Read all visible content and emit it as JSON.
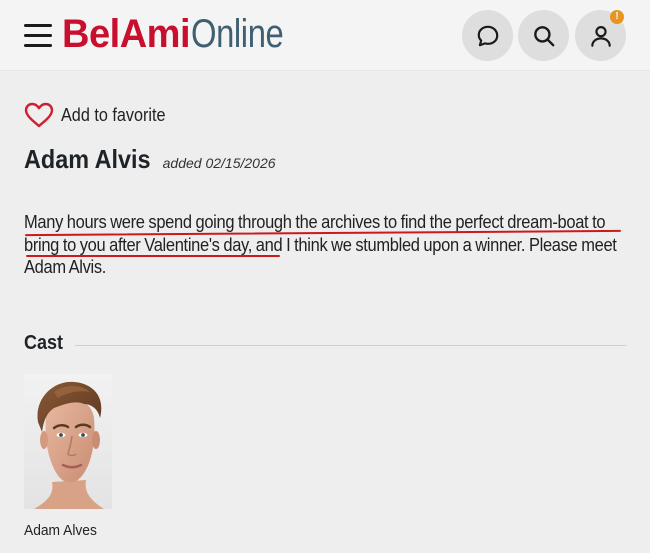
{
  "header": {
    "logo_part1": "BelAmi",
    "logo_part2": "Online",
    "brand_red": "#c8102e",
    "brand_slate": "#3f5f73",
    "menu_icon": "hamburger-menu-icon",
    "chat_icon": "chat-bubble-icon",
    "search_icon": "search-icon",
    "user_icon": "user-icon",
    "notification_badge": "!",
    "badge_color": "#e8951f"
  },
  "favorite": {
    "icon": "heart-outline-icon",
    "label": "Add to favorite"
  },
  "model": {
    "name": "Adam Alvis",
    "added": "added 02/15/2026"
  },
  "description": "Many hours were spend going through the archives to find the perfect dream-boat to bring to you after Valentine's day, and I think we stumbled upon a winner. Please meet Adam Alvis.",
  "cast": {
    "heading": "Cast",
    "members": [
      {
        "name": "Adam Alves"
      }
    ]
  }
}
